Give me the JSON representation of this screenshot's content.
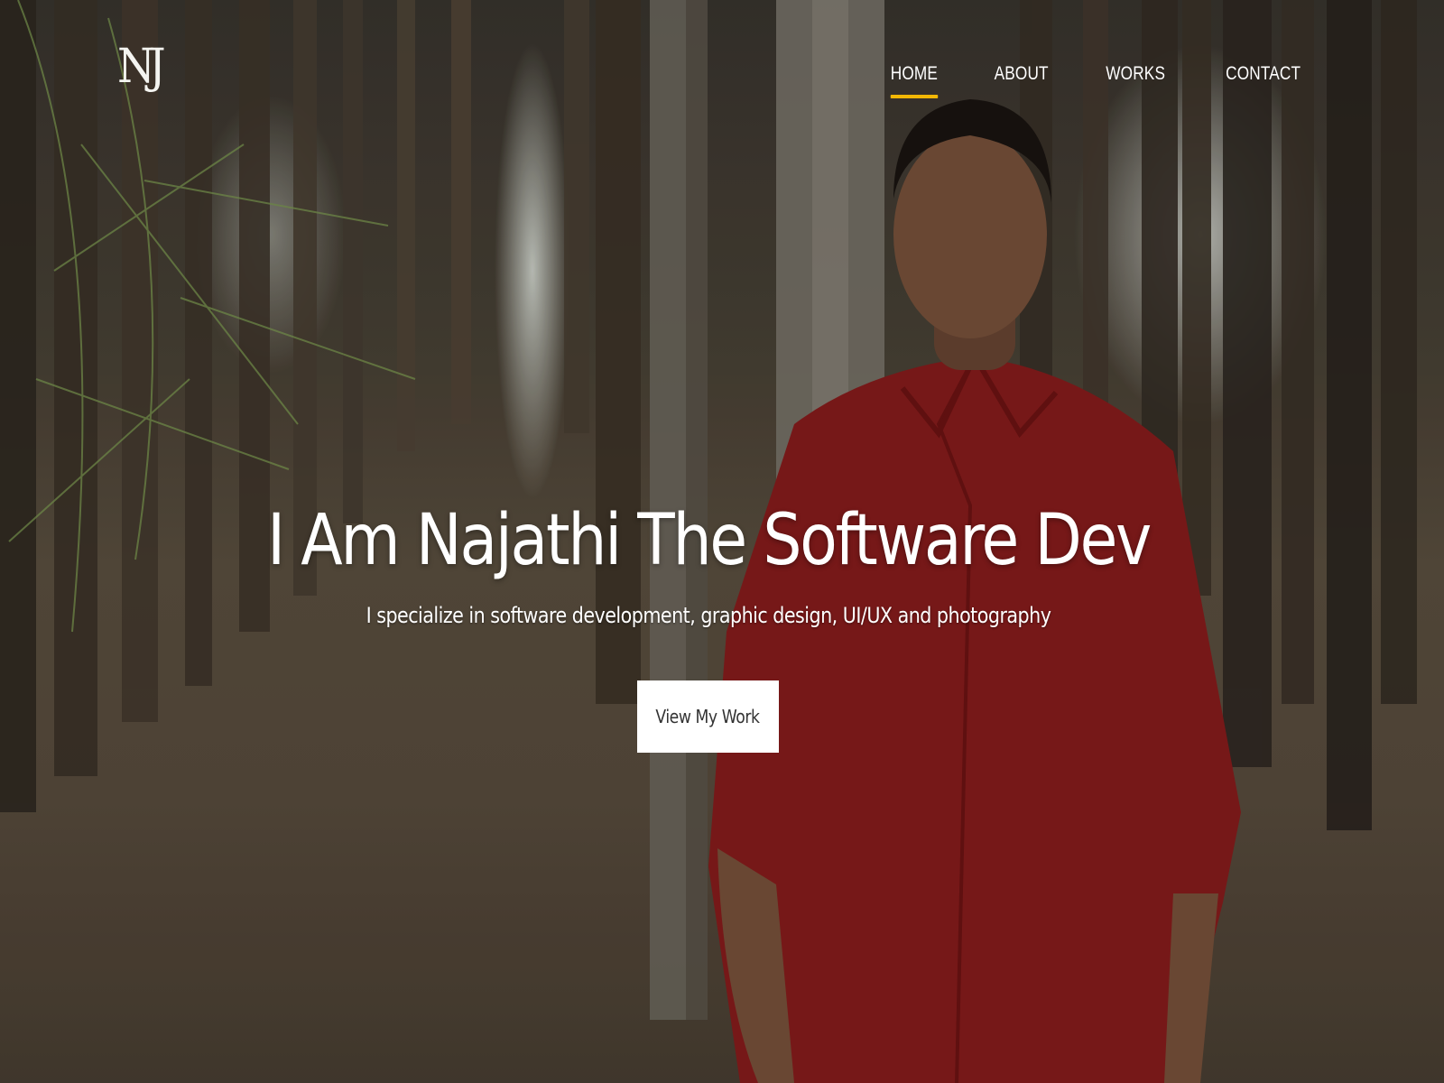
{
  "brand": {
    "logo_text": "NJ"
  },
  "nav": {
    "items": [
      {
        "label": "HOME",
        "active": true
      },
      {
        "label": "ABOUT",
        "active": false
      },
      {
        "label": "WORKS",
        "active": false
      },
      {
        "label": "CONTACT",
        "active": false
      }
    ],
    "active_indicator_color": "#f2b705"
  },
  "hero": {
    "headline": "I Am Najathi The Software Dev",
    "tagline": "I specialize in software development, graphic design, UI/UX and photography",
    "cta_label": "View My Work"
  }
}
